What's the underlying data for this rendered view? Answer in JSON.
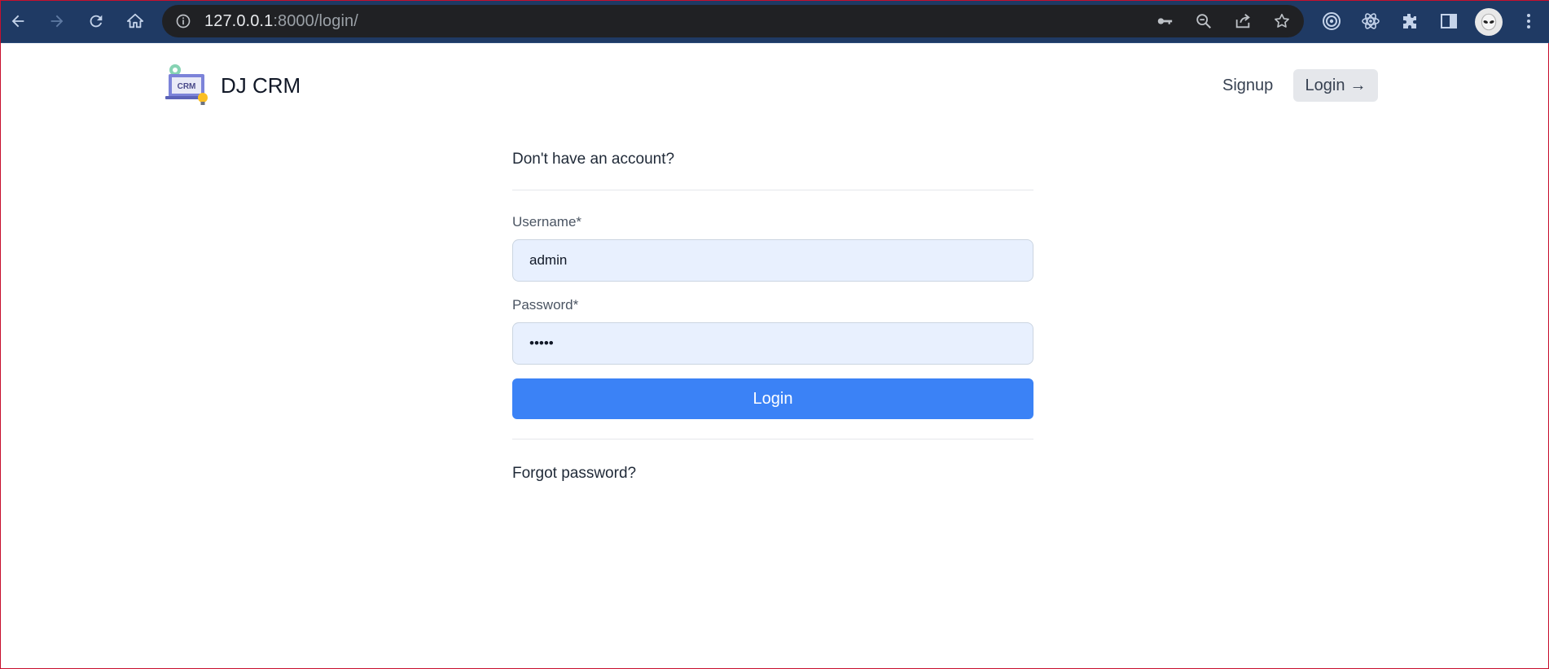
{
  "browser": {
    "url_host": "127.0.0.1",
    "url_path": ":8000/login/"
  },
  "header": {
    "logo_text": "CRM",
    "brand": "DJ CRM",
    "signup_label": "Signup",
    "login_label": "Login",
    "login_arrow": "→"
  },
  "form": {
    "no_account_text": "Don't have an account?",
    "username_label": "Username*",
    "username_value": "admin",
    "password_label": "Password*",
    "password_value": "admin",
    "submit_label": "Login",
    "forgot_text": "Forgot password?"
  },
  "colors": {
    "chrome_bg": "#1f3a64",
    "omnibox_bg": "#202124",
    "accent": "#3b82f6",
    "field_bg": "#e8f0fe"
  }
}
